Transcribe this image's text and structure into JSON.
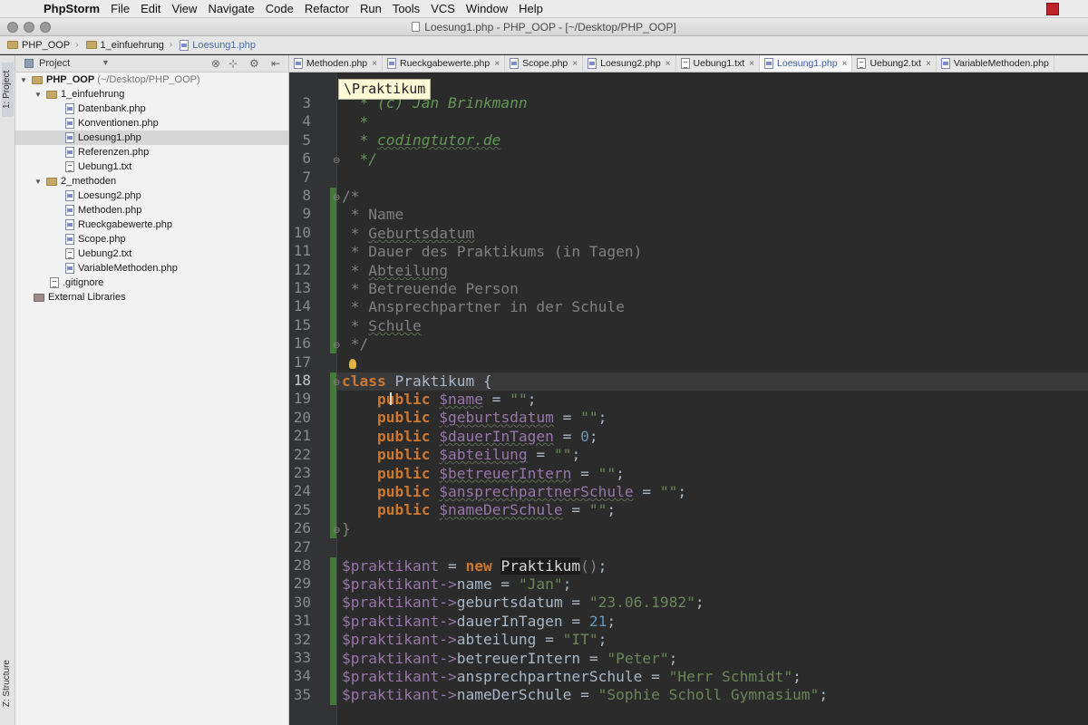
{
  "menubar": {
    "app": "PhpStorm",
    "items": [
      "File",
      "Edit",
      "View",
      "Navigate",
      "Code",
      "Refactor",
      "Run",
      "Tools",
      "VCS",
      "Window",
      "Help"
    ]
  },
  "window": {
    "title": "Loesung1.php - PHP_OOP - [~/Desktop/PHP_OOP]"
  },
  "navbar": {
    "crumbs": [
      "PHP_OOP",
      "1_einfuehrung",
      "Loesung1.php"
    ]
  },
  "toolstripe": {
    "project": "1: Project",
    "structure": "Z: Structure"
  },
  "project_panel": {
    "label": "Project",
    "root": "PHP_OOP",
    "root_path": "(~/Desktop/PHP_OOP)",
    "folder1": "1_einfuehrung",
    "folder1_files": [
      "Datenbank.php",
      "Konventionen.php",
      "Loesung1.php",
      "Referenzen.php",
      "Uebung1.txt"
    ],
    "folder2": "2_methoden",
    "folder2_files": [
      "Loesung2.php",
      "Methoden.php",
      "Rueckgabewerte.php",
      "Scope.php",
      "Uebung2.txt",
      "VariableMethoden.php"
    ],
    "gitignore": ".gitignore",
    "external": "External Libraries"
  },
  "tabs": [
    "Methoden.php",
    "Rueckgabewerte.php",
    "Scope.php",
    "Loesung2.php",
    "Uebung1.txt",
    "Loesung1.php",
    "Uebung2.txt",
    "VariableMethoden.php"
  ],
  "active_tab": "Loesung1.php",
  "editor": {
    "breadcrumb_popup": "\\Praktikum",
    "line_numbers": [
      "3",
      "4",
      "5",
      "6",
      "7",
      "8",
      "9",
      "10",
      "11",
      "12",
      "13",
      "14",
      "15",
      "16",
      "17",
      "18",
      "19",
      "20",
      "21",
      "22",
      "23",
      "24",
      "25",
      "26",
      "27",
      "28",
      "29",
      "30",
      "31",
      "32",
      "33",
      "34",
      "35"
    ],
    "current_line": "18",
    "class_name": "Praktikum",
    "comment_header": [
      "* (c) Jan Brinkmann",
      "*",
      "codingtutor.de",
      "*/"
    ],
    "doc_lines": [
      "/*",
      "* Name",
      "Geburtsdatum",
      "Dauer des Praktikums (in Tagen)",
      "Abteilung",
      "Betreuende Person",
      "Ansprechpartner in der Schule",
      "Schule",
      "*/"
    ],
    "properties": [
      {
        "name": "$name",
        "value": "\"\""
      },
      {
        "name": "$geburtsdatum",
        "value": "\"\""
      },
      {
        "name": "$dauerInTagen",
        "value": "0"
      },
      {
        "name": "$abteilung",
        "value": "\"\""
      },
      {
        "name": "$betreuerIntern",
        "value": "\"\""
      },
      {
        "name": "$ansprechpartnerSchule",
        "value": "\"\""
      },
      {
        "name": "$nameDerSchule",
        "value": "\"\""
      }
    ],
    "instance_var": "$praktikant",
    "assignments": [
      {
        "prop": "name",
        "value": "\"Jan\""
      },
      {
        "prop": "geburtsdatum",
        "value": "\"23.06.1982\""
      },
      {
        "prop": "dauerInTagen",
        "value": "21"
      },
      {
        "prop": "abteilung",
        "value": "\"IT\""
      },
      {
        "prop": "betreuerIntern",
        "value": "\"Peter\""
      },
      {
        "prop": "ansprechpartnerSchule",
        "value": "\"Herr Schmidt\""
      },
      {
        "prop": "nameDerSchule",
        "value": "\"Sophie Scholl Gymnasium\""
      }
    ]
  },
  "colors": {
    "keyword": "#cc7832",
    "variable": "#9876aa",
    "string": "#6a8759",
    "number": "#6897bb",
    "comment": "#808080",
    "editor_bg": "#2b2b2b"
  }
}
